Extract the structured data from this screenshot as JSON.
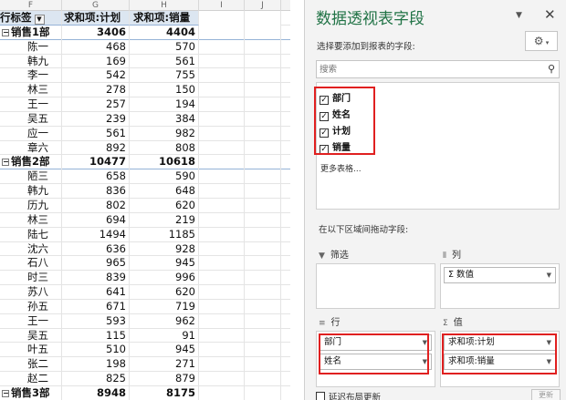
{
  "columns": [
    "F",
    "G",
    "H",
    "I",
    "J"
  ],
  "pivot": {
    "header": {
      "row_label": "行标签",
      "sum_plan": "求和项:计划",
      "sum_sales": "求和项:销量"
    },
    "rows": [
      {
        "label": "销售1部",
        "plan": "3406",
        "sales": "4404",
        "group": true
      },
      {
        "label": "陈一",
        "plan": "468",
        "sales": "570"
      },
      {
        "label": "韩九",
        "plan": "169",
        "sales": "561"
      },
      {
        "label": "李一",
        "plan": "542",
        "sales": "755"
      },
      {
        "label": "林三",
        "plan": "278",
        "sales": "150"
      },
      {
        "label": "王一",
        "plan": "257",
        "sales": "194"
      },
      {
        "label": "吴五",
        "plan": "239",
        "sales": "384"
      },
      {
        "label": "应一",
        "plan": "561",
        "sales": "982"
      },
      {
        "label": "章六",
        "plan": "892",
        "sales": "808"
      },
      {
        "label": "销售2部",
        "plan": "10477",
        "sales": "10618",
        "group": true
      },
      {
        "label": "陋三",
        "plan": "658",
        "sales": "590"
      },
      {
        "label": "韩九",
        "plan": "836",
        "sales": "648"
      },
      {
        "label": "历九",
        "plan": "802",
        "sales": "620"
      },
      {
        "label": "林三",
        "plan": "694",
        "sales": "219"
      },
      {
        "label": "陆七",
        "plan": "1494",
        "sales": "1185"
      },
      {
        "label": "沈六",
        "plan": "636",
        "sales": "928"
      },
      {
        "label": "石八",
        "plan": "965",
        "sales": "945"
      },
      {
        "label": "时三",
        "plan": "839",
        "sales": "996"
      },
      {
        "label": "苏八",
        "plan": "641",
        "sales": "620"
      },
      {
        "label": "孙五",
        "plan": "671",
        "sales": "719"
      },
      {
        "label": "王一",
        "plan": "593",
        "sales": "962"
      },
      {
        "label": "吴五",
        "plan": "115",
        "sales": "91"
      },
      {
        "label": "叶五",
        "plan": "510",
        "sales": "945"
      },
      {
        "label": "张二",
        "plan": "198",
        "sales": "271"
      },
      {
        "label": "赵二",
        "plan": "825",
        "sales": "879"
      },
      {
        "label": "销售3部",
        "plan": "8948",
        "sales": "8175",
        "group": true
      }
    ]
  },
  "pane": {
    "title": "数据透视表字段",
    "choose_label": "选择要添加到报表的字段:",
    "search_placeholder": "搜索",
    "fields": [
      {
        "label": "部门",
        "checked": true
      },
      {
        "label": "姓名",
        "checked": true
      },
      {
        "label": "计划",
        "checked": true
      },
      {
        "label": "销量",
        "checked": true
      }
    ],
    "more_tables": "更多表格...",
    "drag_label": "在以下区域间拖动字段:",
    "areas": {
      "filters": {
        "title": "筛选",
        "icon": "▼"
      },
      "columns": {
        "title": "列",
        "icon": "⦀",
        "items": [
          "Σ 数值"
        ]
      },
      "rows": {
        "title": "行",
        "icon": "≡",
        "items": [
          "部门",
          "姓名"
        ]
      },
      "values": {
        "title": "值",
        "icon": "Σ",
        "items": [
          "求和项:计划",
          "求和项:销量"
        ]
      }
    },
    "defer_label": "延迟布局更新",
    "update_button": "更新"
  }
}
